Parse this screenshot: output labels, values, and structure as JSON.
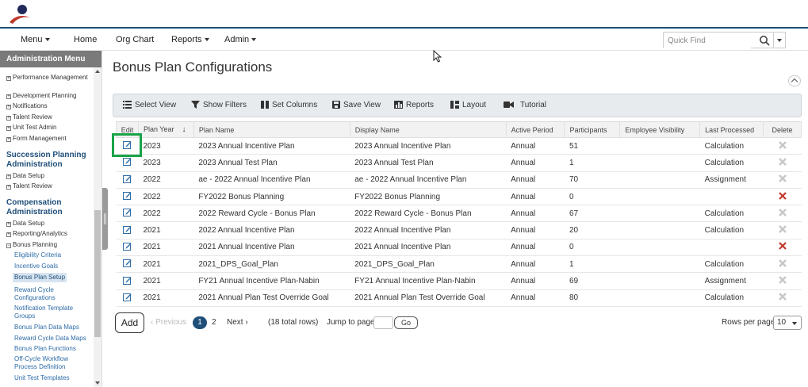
{
  "nav": {
    "menu": "Menu",
    "home": "Home",
    "org_chart": "Org Chart",
    "reports": "Reports",
    "admin": "Admin",
    "quick_find_placeholder": "Quick Find"
  },
  "sidebar": {
    "header": "Administration Menu",
    "items": [
      {
        "label": "Performance Management",
        "type": "expand"
      },
      {
        "label": "Development Planning",
        "type": "expand"
      },
      {
        "label": "Notifications",
        "type": "expand"
      },
      {
        "label": "Talent Review",
        "type": "expand"
      },
      {
        "label": "Unit Test Admin",
        "type": "expand"
      },
      {
        "label": "Form Management",
        "type": "expand"
      }
    ],
    "section_succession": "Succession Planning Administration",
    "succession_items": [
      "Data Setup",
      "Talent Review"
    ],
    "section_compensation": "Compensation Administration",
    "compensation_items": [
      "Data Setup",
      "Reporting/Analytics",
      "Bonus Planning"
    ],
    "bonus_subitems": [
      "Eligibility Criteria",
      "Incentive Goals",
      "Bonus Plan Setup",
      "Reward Cycle Configurations",
      "Notification Template Groups",
      "Bonus Plan Data Maps",
      "Reward Cycle Data Maps",
      "Bonus Plan Functions",
      "Off-Cycle Workflow Process Definition",
      "Unit Test Templates"
    ],
    "active_subitem": "Bonus Plan Setup"
  },
  "page": {
    "title": "Bonus Plan Configurations"
  },
  "toolbar": {
    "select_view": "Select View",
    "show_filters": "Show Filters",
    "set_columns": "Set Columns",
    "save_view": "Save View",
    "reports": "Reports",
    "layout": "Layout",
    "tutorial": "Tutorial"
  },
  "table": {
    "columns": [
      "Edit",
      "Plan Year",
      "Plan Name",
      "Display Name",
      "Active Period",
      "Participants",
      "Employee Visibility",
      "Last Processed",
      "Delete"
    ],
    "sort_indicator": "↓",
    "rows": [
      {
        "year": "2023",
        "plan": "2023 Annual Incentive Plan",
        "display": "2023 Annual Incentive Plan",
        "period": "Annual",
        "participants": "51",
        "visibility": "",
        "last": "Calculation",
        "deletable": false
      },
      {
        "year": "2023",
        "plan": "2023 Annual Test Plan",
        "display": "2023 Annual Test Plan",
        "period": "Annual",
        "participants": "1",
        "visibility": "",
        "last": "Calculation",
        "deletable": false
      },
      {
        "year": "2022",
        "plan": "ae - 2022 Annual Incentive Plan",
        "display": "ae - 2022 Annual Incentive Plan",
        "period": "Annual",
        "participants": "70",
        "visibility": "",
        "last": "Assignment",
        "deletable": false
      },
      {
        "year": "2022",
        "plan": "FY2022 Bonus Planning",
        "display": "FY2022 Bonus Planning",
        "period": "Annual",
        "participants": "0",
        "visibility": "",
        "last": "",
        "deletable": true
      },
      {
        "year": "2022",
        "plan": "2022 Reward Cycle - Bonus Plan",
        "display": "2022 Reward Cycle - Bonus Plan",
        "period": "Annual",
        "participants": "67",
        "visibility": "",
        "last": "Calculation",
        "deletable": false
      },
      {
        "year": "2021",
        "plan": "2022 Annual Incentive Plan",
        "display": "2022 Annual Incentive Plan",
        "period": "Annual",
        "participants": "20",
        "visibility": "",
        "last": "Calculation",
        "deletable": false
      },
      {
        "year": "2021",
        "plan": "2021 Annual Incentive Plan",
        "display": "2021 Annual Incentive Plan",
        "period": "Annual",
        "participants": "0",
        "visibility": "",
        "last": "",
        "deletable": true
      },
      {
        "year": "2021",
        "plan": "2021_DPS_Goal_Plan",
        "display": "2021_DPS_Goal_Plan",
        "period": "Annual",
        "participants": "1",
        "visibility": "",
        "last": "Calculation",
        "deletable": false
      },
      {
        "year": "2021",
        "plan": "FY21 Annual Incentive Plan-Nabin",
        "display": "FY21 Annual Incentive Plan-Nabin",
        "period": "Annual",
        "participants": "69",
        "visibility": "",
        "last": "Assignment",
        "deletable": false
      },
      {
        "year": "2021",
        "plan": "2021 Annual Plan Test Override Goal",
        "display": "2021 Annual Plan Test Override Goal",
        "period": "Annual",
        "participants": "80",
        "visibility": "",
        "last": "Calculation",
        "deletable": false
      }
    ]
  },
  "footer": {
    "add": "Add",
    "previous": "Previous",
    "page_current": "1",
    "page_2": "2",
    "next": "Next",
    "total_rows": "(18 total rows)",
    "jump_to_page": "Jump to page:",
    "go": "Go",
    "rows_per_page": "Rows per page:",
    "rows_per_page_value": "10"
  },
  "colors": {
    "brand_navy": "#1f4e79",
    "highlight_green": "#1aa34a",
    "delete_red": "#c0392b",
    "delete_disabled": "#c8c8c8",
    "edit_icon": "#2d6ca8"
  }
}
